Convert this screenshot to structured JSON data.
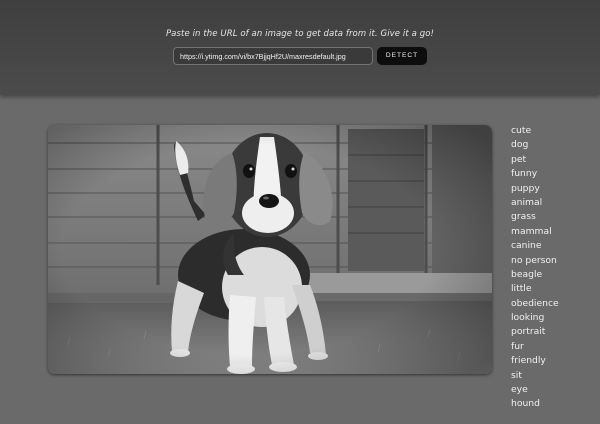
{
  "header": {
    "tagline": "Paste in the URL of an image to get data from it. Give it a go!",
    "url_value": "https://i.ytimg.com/vi/bx7BjjqHf2U/maxresdefault.jpg",
    "detect_label": "DETECT"
  },
  "photo": {
    "subject": "beagle puppy on grass in front of wooden shed",
    "style": "grayscale"
  },
  "tags": [
    "cute",
    "dog",
    "pet",
    "funny",
    "puppy",
    "animal",
    "grass",
    "mammal",
    "canine",
    "no person",
    "beagle",
    "little",
    "obedience",
    "looking",
    "portrait",
    "fur",
    "friendly",
    "sit",
    "eye",
    "hound"
  ],
  "colors": {
    "page_background": "#6a6a6a",
    "header_background": "#434343",
    "button_background": "#0d0d0d",
    "text_light": "#f1f1f1"
  }
}
